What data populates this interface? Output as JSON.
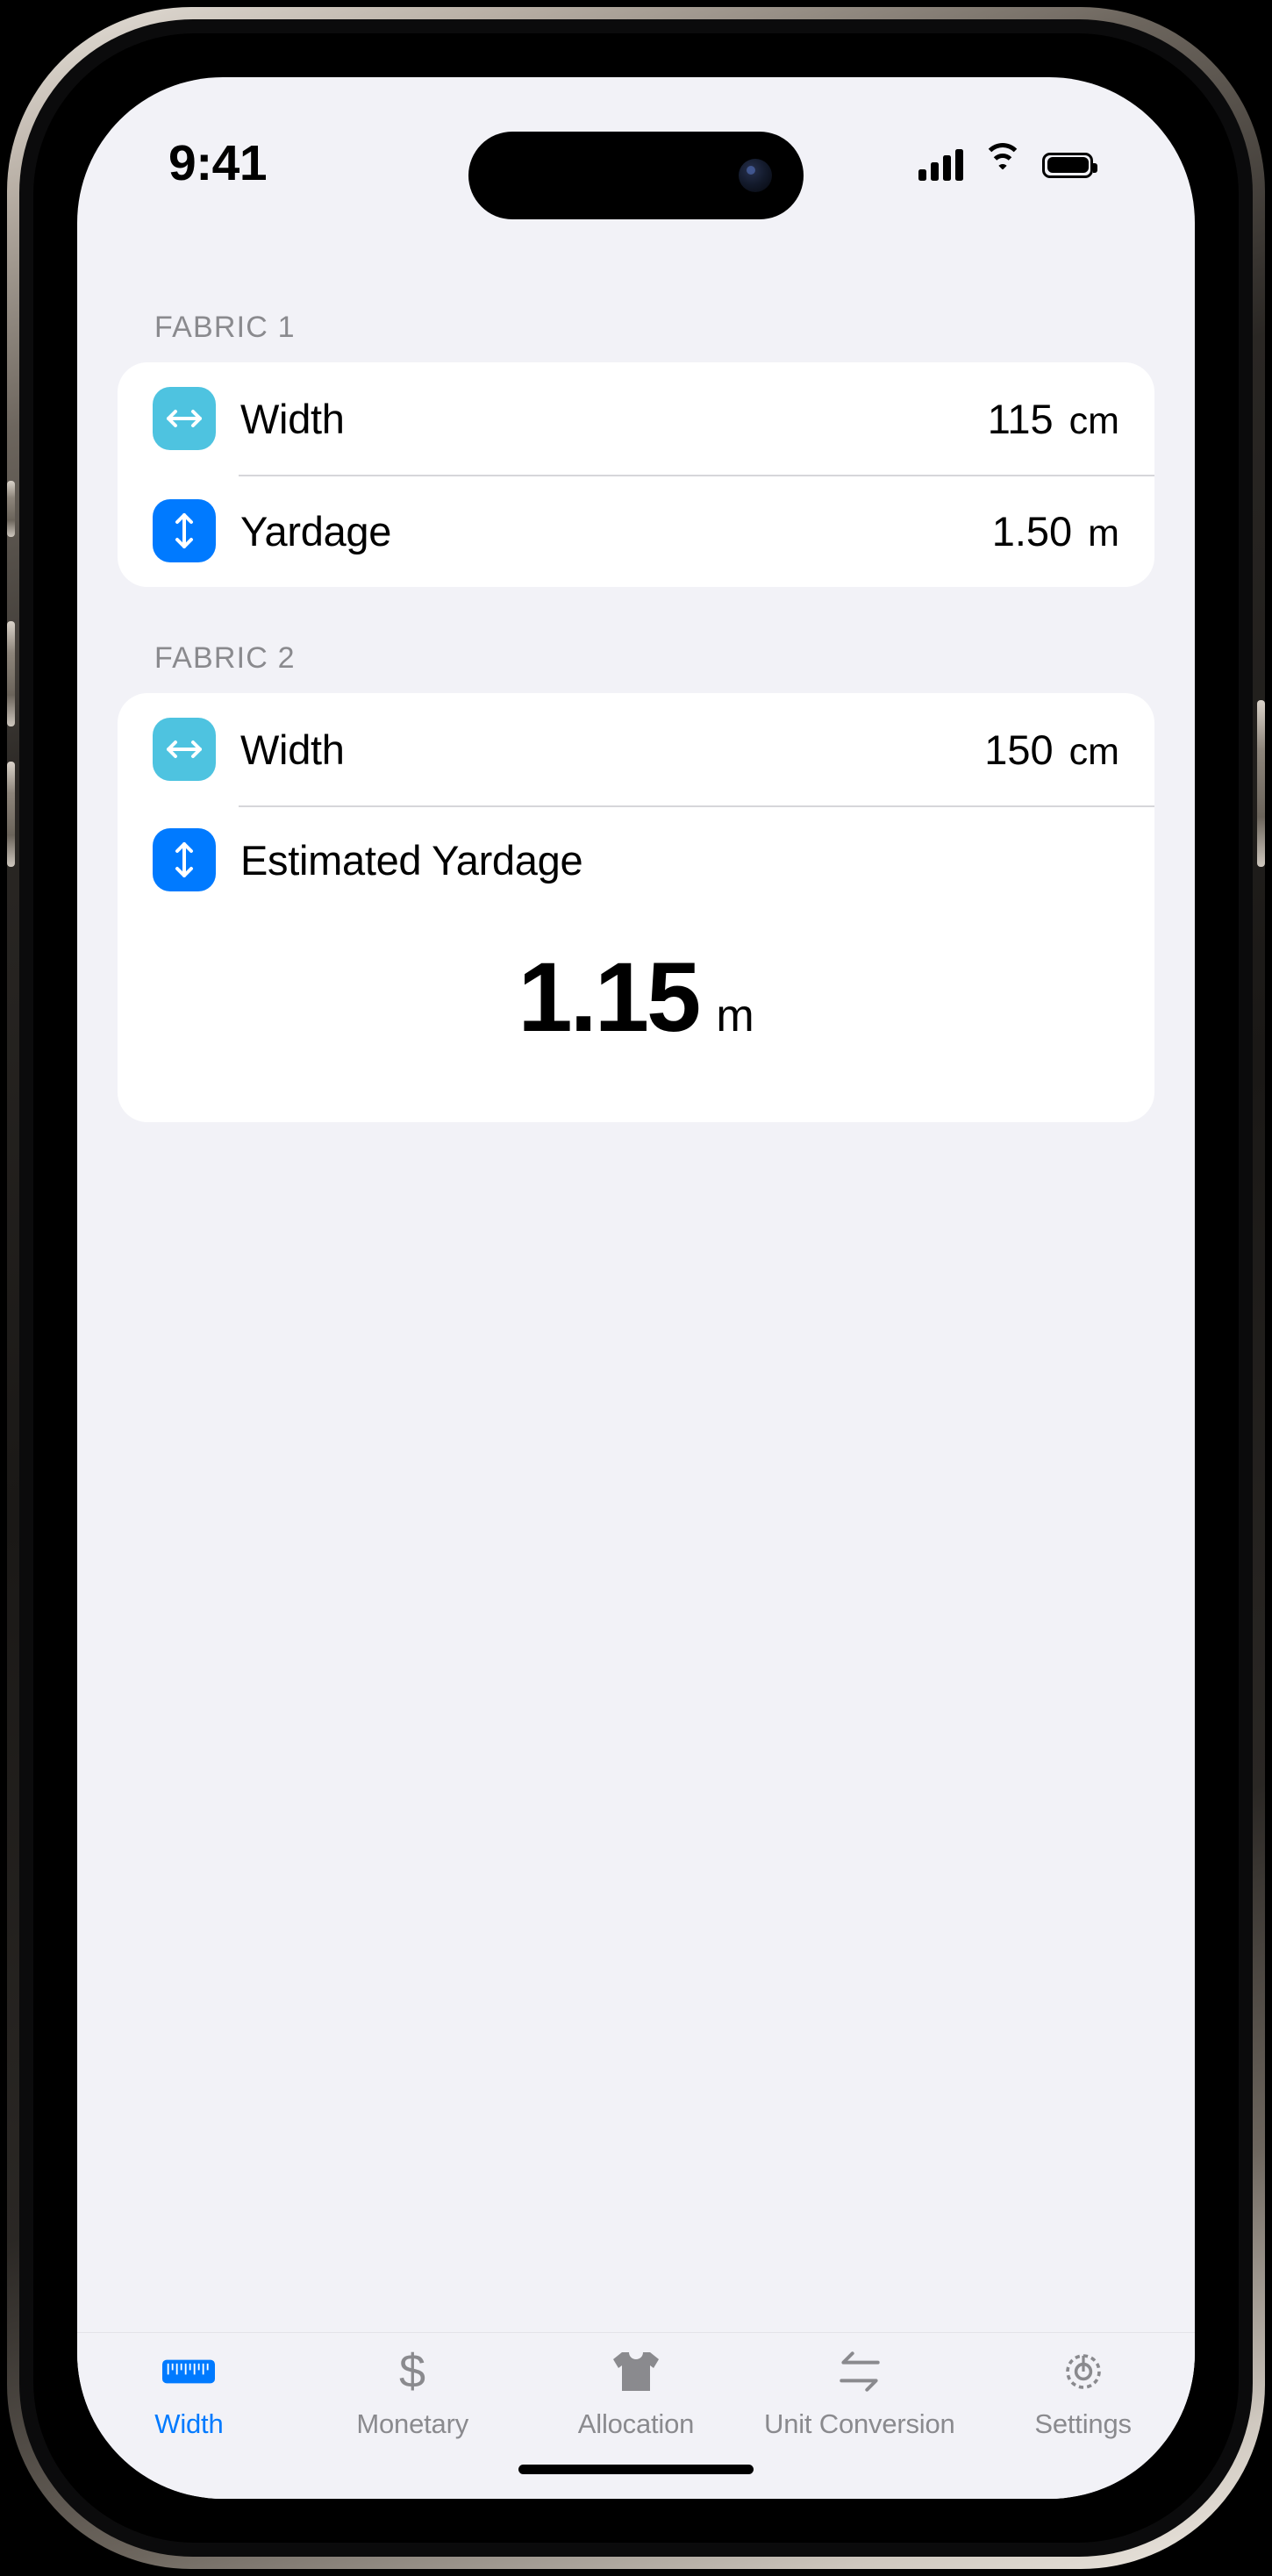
{
  "status_bar": {
    "time": "9:41",
    "signal_icon": "cellular-signal-icon",
    "wifi_icon": "wifi-icon",
    "battery_icon": "battery-icon"
  },
  "sections": [
    {
      "label": "FABRIC 1",
      "rows": [
        {
          "icon": "horizontal-arrows-icon",
          "icon_color": "#4ec3e0",
          "label": "Width",
          "value": "115",
          "unit": "cm"
        },
        {
          "icon": "vertical-arrows-icon",
          "icon_color": "#007aff",
          "label": "Yardage",
          "value": "1.50",
          "unit": "m"
        }
      ]
    },
    {
      "label": "FABRIC 2",
      "rows": [
        {
          "icon": "horizontal-arrows-icon",
          "icon_color": "#4ec3e0",
          "label": "Width",
          "value": "150",
          "unit": "cm"
        }
      ],
      "result": {
        "icon": "vertical-arrows-icon",
        "icon_color": "#007aff",
        "label": "Estimated Yardage",
        "value": "1.15",
        "unit": "m"
      }
    }
  ],
  "tabs": [
    {
      "label": "Width",
      "icon": "ruler-icon",
      "active": true
    },
    {
      "label": "Monetary",
      "icon": "dollar-icon",
      "active": false
    },
    {
      "label": "Allocation",
      "icon": "tshirt-icon",
      "active": false
    },
    {
      "label": "Unit Conversion",
      "icon": "convert-arrows-icon",
      "active": false
    },
    {
      "label": "Settings",
      "icon": "gear-icon",
      "active": false
    }
  ],
  "colors": {
    "accent": "#007aff",
    "cyan": "#4ec3e0",
    "background": "#f2f2f7",
    "card": "#ffffff",
    "secondary_text": "#8a8a8e"
  }
}
